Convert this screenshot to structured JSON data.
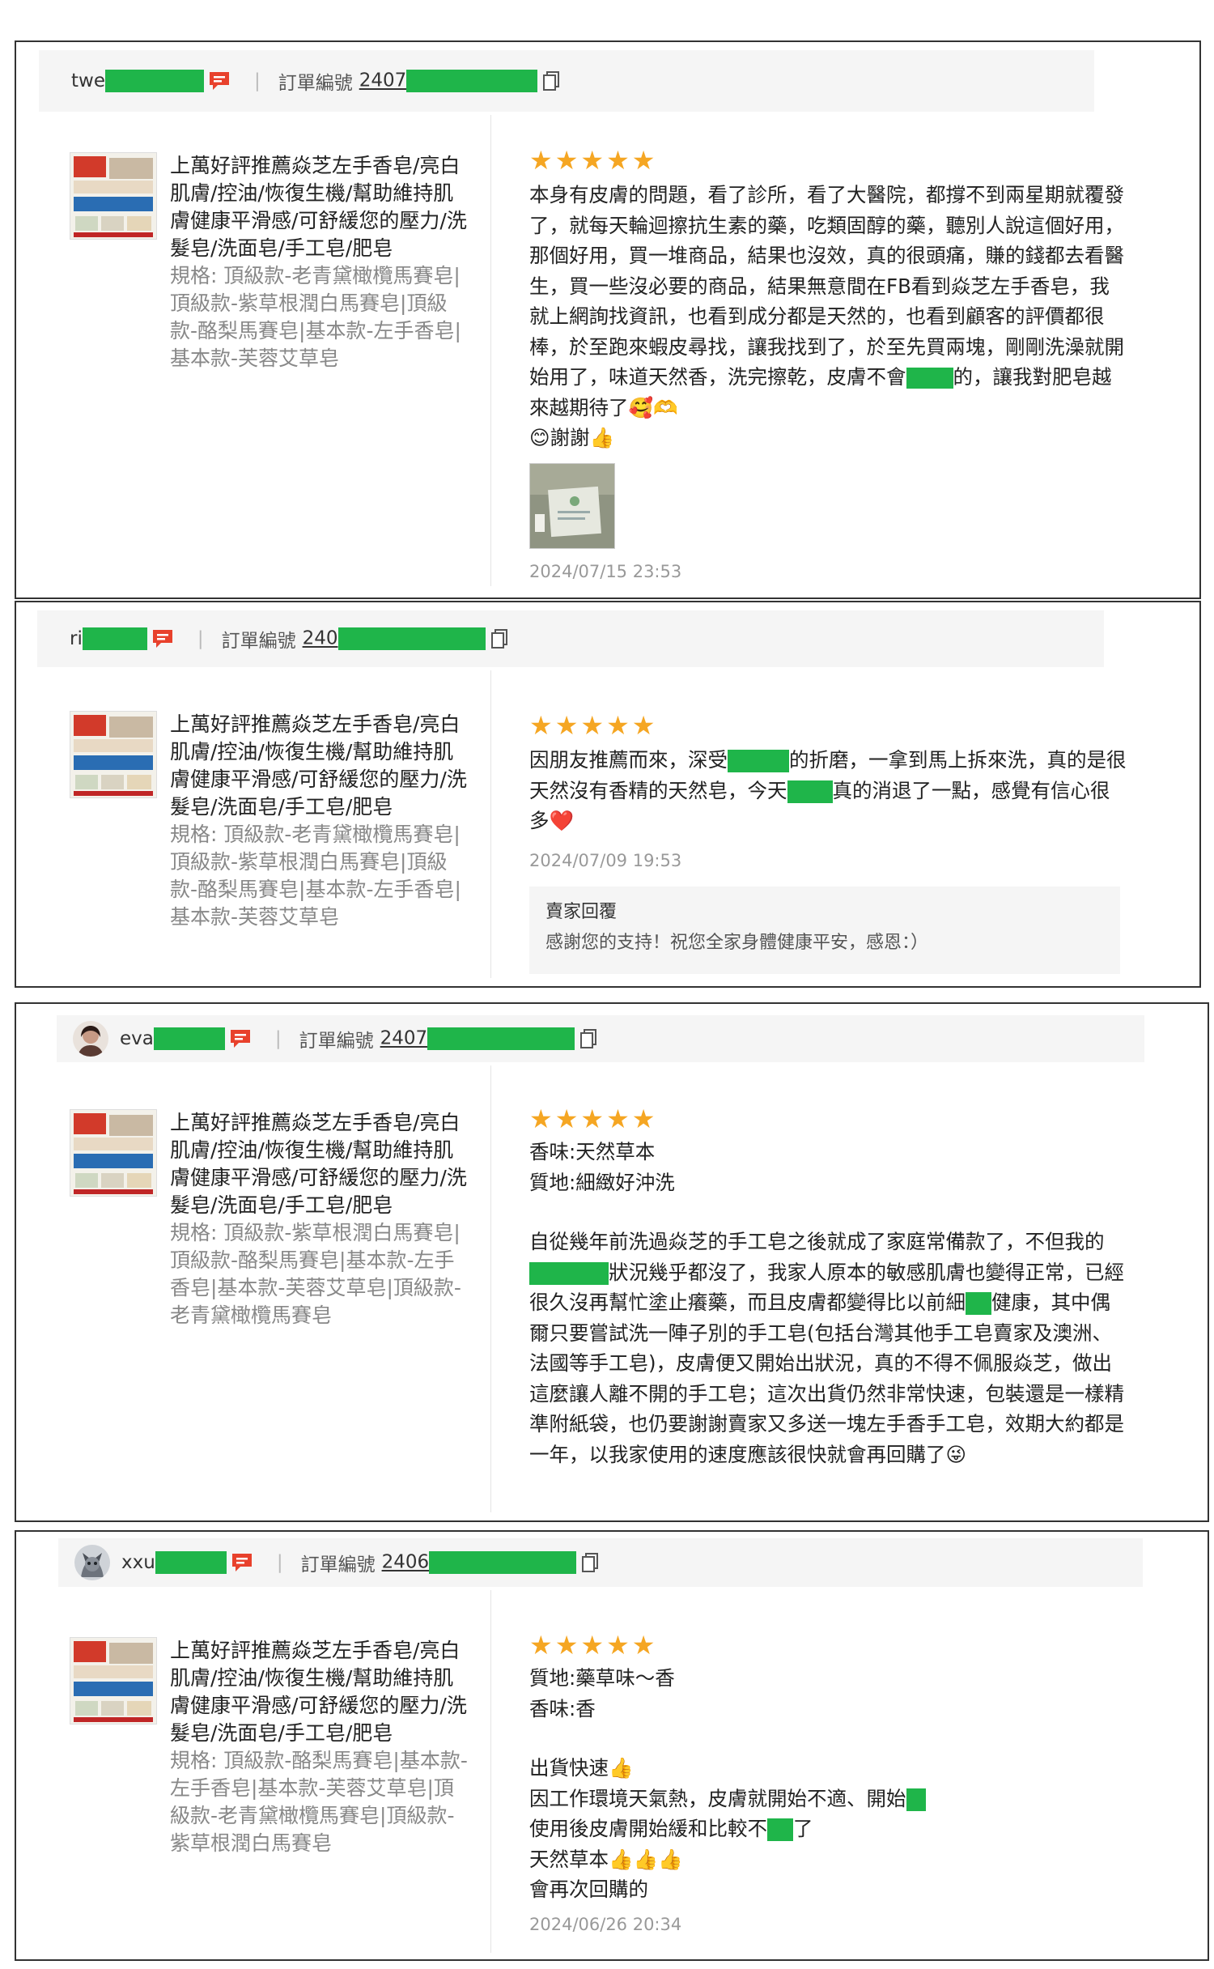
{
  "colors": {
    "redact": "#1fb54a",
    "star": "#f5a623",
    "chat_red": "#e8412c"
  },
  "reviews": [
    {
      "username": "twe",
      "order_label": "訂單編號",
      "order_prefix": "2407",
      "product_title": "上萬好評推薦焱芝左手香皂/亮白肌膚/控油/恢復生機/幫助維持肌膚健康平滑感/可舒緩您的壓力/洗髮皂/洗面皂/手工皂/肥皂",
      "product_variant": "規格: 頂級款-老青黛橄欖馬賽皂|頂級款-紫草根潤白馬賽皂|頂級款-酪梨馬賽皂|基本款-左手香皂|基本款-芙蓉艾草皂",
      "stars": "★★★★★",
      "text_a": "本身有皮膚的問題，看了診所，看了大醫院，都撐不到兩星期就覆發了，就每天輪迴擦抗生素的藥，吃類固醇的藥，聽別人說這個好用，那個好用，買一堆商品，結果也沒效，真的很頭痛，賺的錢都去看醫生，買一些沒必要的商品，結果無意間在FB看到焱芝左手香皂，我就上網詢找資訊，也看到成分都是天然的，也看到顧客的評價都很棒，於至跑來蝦皮尋找，讓我找到了，於至先買兩塊，剛剛洗澡就開始用了，味道天然香，洗完擦乾，皮膚不會",
      "text_b": "的，讓我對肥皂越來越期待了🥰🫶",
      "text_c": "😊謝謝👍",
      "date": "2024/07/15 23:53"
    },
    {
      "username": "ri",
      "order_label": "訂單編號",
      "order_prefix": "240",
      "product_title": "上萬好評推薦焱芝左手香皂/亮白肌膚/控油/恢復生機/幫助維持肌膚健康平滑感/可舒緩您的壓力/洗髮皂/洗面皂/手工皂/肥皂",
      "product_variant": "規格: 頂級款-老青黛橄欖馬賽皂|頂級款-紫草根潤白馬賽皂|頂級款-酪梨馬賽皂|基本款-左手香皂|基本款-芙蓉艾草皂",
      "stars": "★★★★★",
      "text_a": "因朋友推薦而來，深受",
      "text_b": "的折磨，一拿到馬上拆來洗，真的是很天然沒有香精的天然皂，今天",
      "text_c": "真的消退了一點，感覺有信心很多❤️",
      "date": "2024/07/09 19:53",
      "seller_title": "賣家回覆",
      "seller_text": "感謝您的支持！祝您全家身體健康平安，感恩：）"
    },
    {
      "username": "eva",
      "order_label": "訂單編號",
      "order_prefix": "2407",
      "product_title": "上萬好評推薦焱芝左手香皂/亮白肌膚/控油/恢復生機/幫助維持肌膚健康平滑感/可舒緩您的壓力/洗髮皂/洗面皂/手工皂/肥皂",
      "product_variant": "規格: 頂級款-紫草根潤白馬賽皂|頂級款-酪梨馬賽皂|基本款-左手香皂|基本款-芙蓉艾草皂|頂級款-老青黛橄欖馬賽皂",
      "stars": "★★★★★",
      "line1": "香味:天然草本",
      "line2": "質地:細緻好沖洗",
      "text_a": "自從幾年前洗過焱芝的手工皂之後就成了家庭常備款了，不但我的",
      "text_b": "狀況幾乎都沒了，我家人原本的敏感肌膚也變得正常，已經很久沒再幫忙塗止癢藥，而且皮膚都變得比以前細",
      "text_c": "健康，其中偶爾只要嘗試洗一陣子別的手工皂(包括台灣其他手工皂賣家及澳洲、法國等手工皂)，皮膚便又開始出狀況，真的不得不佩服焱芝，做出這麼讓人離不開的手工皂；這次出貨仍然非常快速，包裝還是一樣精準附紙袋，也仍要謝謝賣家又多送一塊左手香手工皂，效期大約都是一年，以我家使用的速度應該很快就會再回購了😜"
    },
    {
      "username": "xxu",
      "order_label": "訂單編號",
      "order_prefix": "2406",
      "product_title": "上萬好評推薦焱芝左手香皂/亮白肌膚/控油/恢復生機/幫助維持肌膚健康平滑感/可舒緩您的壓力/洗髮皂/洗面皂/手工皂/肥皂",
      "product_variant": "規格: 頂級款-酪梨馬賽皂|基本款-左手香皂|基本款-芙蓉艾草皂|頂級款-老青黛橄欖馬賽皂|頂級款-紫草根潤白馬賽皂",
      "stars": "★★★★★",
      "line1": "質地:藥草味～香",
      "line2": "香味:香",
      "line3": "出貨快速👍",
      "line4": "因工作環境天氣熱，皮膚就開始不適、開始",
      "line5a": "使用後皮膚開始緩和比較不",
      "line5b": "了",
      "line6": "天然草本👍👍👍",
      "line7": "會再次回購的",
      "date": "2024/06/26 20:34"
    }
  ]
}
